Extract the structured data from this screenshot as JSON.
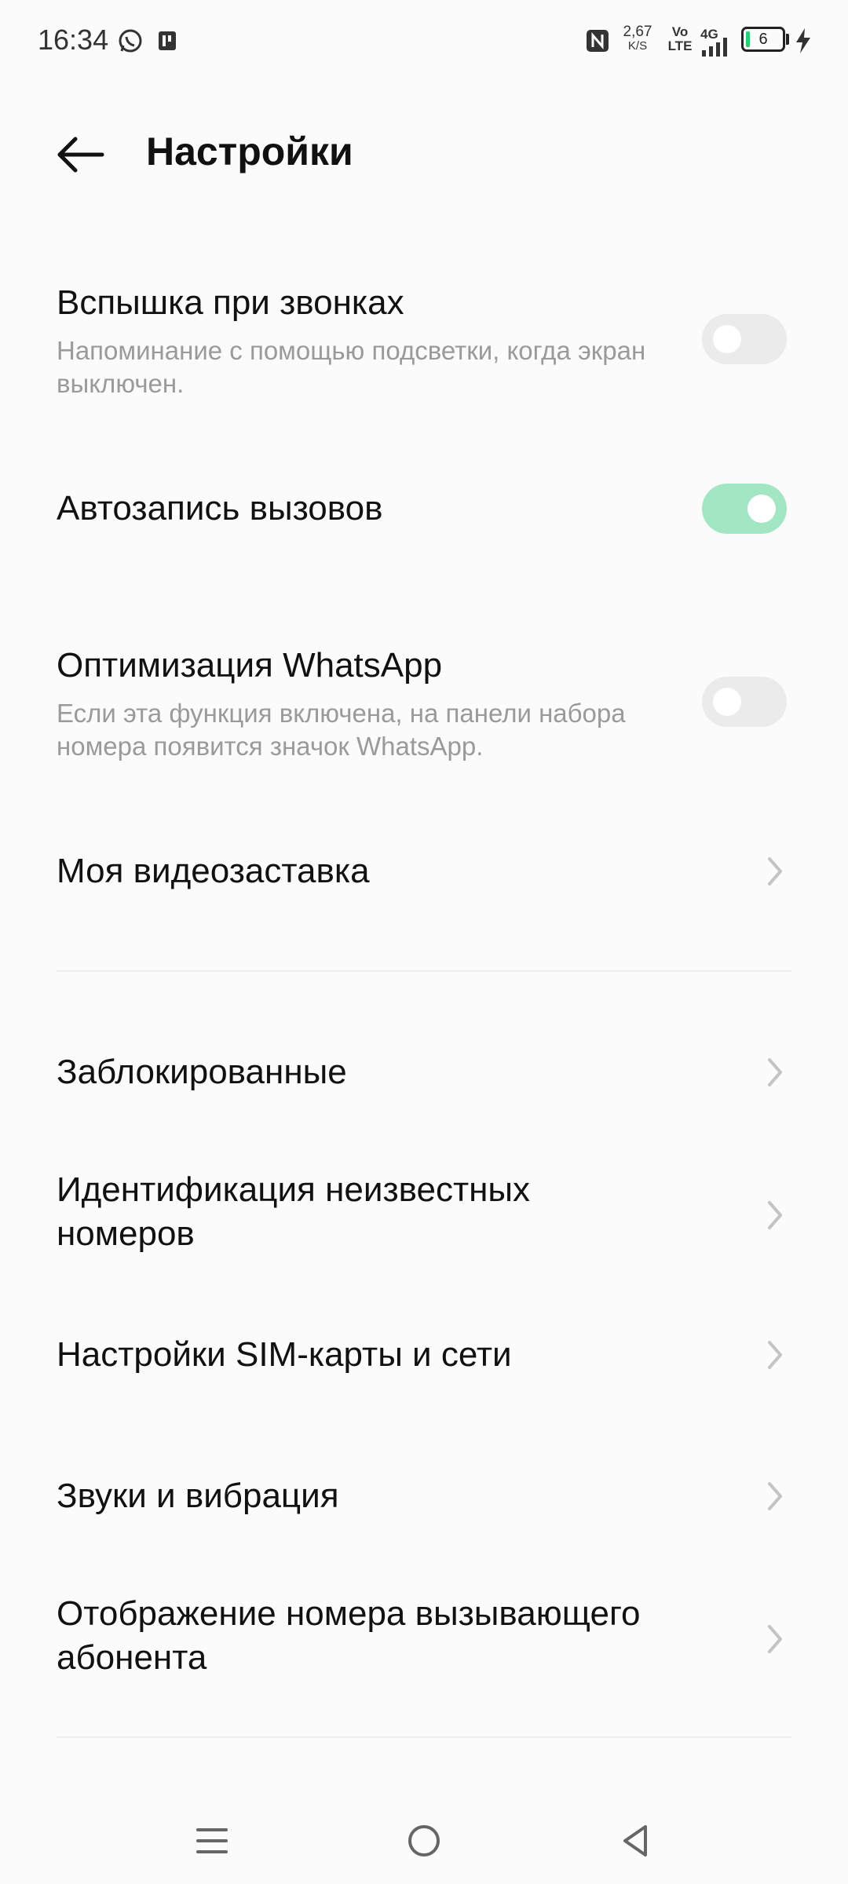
{
  "status_bar": {
    "time": "16:34",
    "net_speed_value": "2,67",
    "net_speed_unit": "K/S",
    "volte_top": "Vo",
    "volte_bottom": "LTE",
    "network_type": "4G",
    "battery_level": "6",
    "icons": [
      "whatsapp-icon",
      "notification-icon",
      "nfc-icon",
      "signal-icon",
      "battery-icon",
      "charging-icon"
    ]
  },
  "header": {
    "title": "Настройки",
    "back_icon": "back-arrow-icon"
  },
  "settings": {
    "flash_on_calls": {
      "title": "Вспышка при звонках",
      "subtitle": "Напоминание с помощью подсветки, когда экран выключен.",
      "enabled": false
    },
    "auto_record": {
      "title": "Автозапись вызовов",
      "enabled": true
    },
    "whatsapp_optimization": {
      "title": "Оптимизация WhatsApp",
      "subtitle": "Если эта функция включена, на панели набора номера появится значок WhatsApp.",
      "enabled": false
    },
    "video_ringtone": {
      "title": "Моя видеозаставка"
    },
    "blocked": {
      "title": "Заблокированные"
    },
    "unknown_id": {
      "title": "Идентификация неизвестных номеров"
    },
    "sim_network": {
      "title": "Настройки SIM-карты и сети"
    },
    "sounds_vibration": {
      "title": "Звуки и вибрация"
    },
    "caller_id_display": {
      "title": "Отображение номера вызывающего абонента"
    }
  },
  "colors": {
    "toggle_on": "#a3e6c3",
    "toggle_off": "#ebebeb",
    "subtitle": "#9a9a9a",
    "background": "#fbfbfb"
  },
  "nav_bar": {
    "icons": [
      "menu-icon",
      "home-icon",
      "back-icon"
    ]
  }
}
